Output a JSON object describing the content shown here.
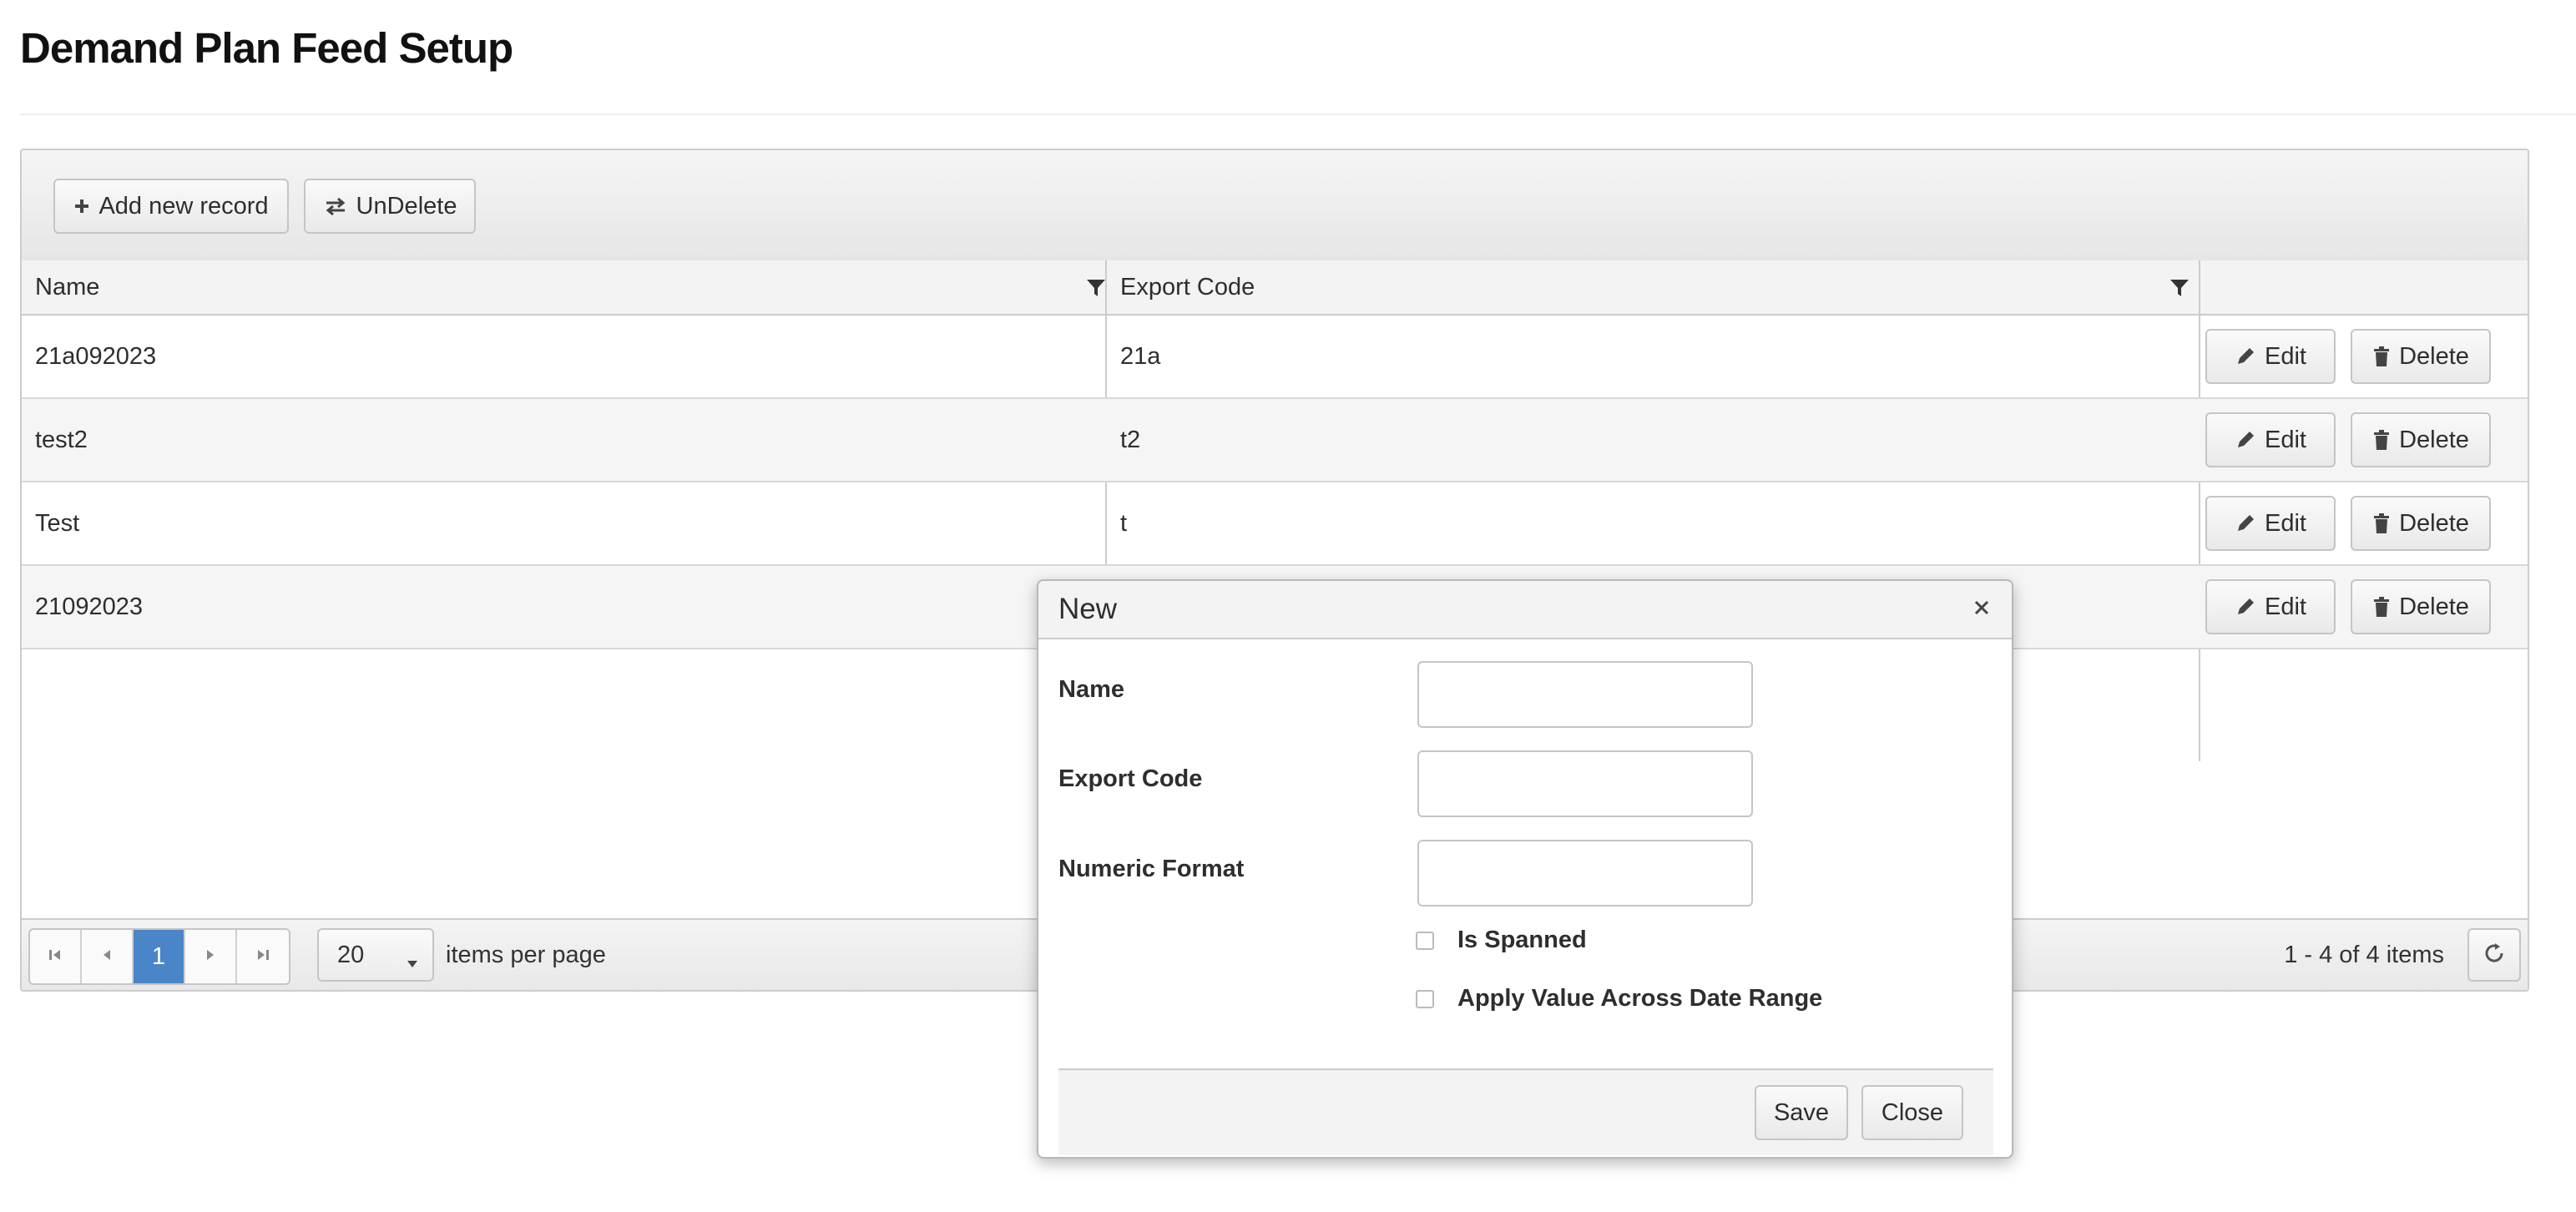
{
  "page": {
    "title": "Demand Plan Feed Setup"
  },
  "toolbar": {
    "add_label": "Add new record",
    "undelete_label": "UnDelete"
  },
  "grid": {
    "columns": [
      "Name",
      "Export Code"
    ],
    "rows": [
      {
        "name": "21a092023",
        "code": "21a"
      },
      {
        "name": "test2",
        "code": "t2"
      },
      {
        "name": "Test",
        "code": "t"
      },
      {
        "name": "21092023",
        "code": ""
      }
    ],
    "edit_label": "Edit",
    "delete_label": "Delete"
  },
  "pager": {
    "current_page": "1",
    "page_size": "20",
    "per_page_label": "items per page",
    "info": "1 - 4 of 4 items"
  },
  "dialog": {
    "title": "New",
    "fields": [
      {
        "label": "Name",
        "value": ""
      },
      {
        "label": "Export Code",
        "value": ""
      },
      {
        "label": "Numeric Format",
        "value": ""
      }
    ],
    "checkboxes": [
      {
        "label": "Is Spanned",
        "checked": false
      },
      {
        "label": "Apply Value Across Date Range",
        "checked": false
      }
    ],
    "save_label": "Save",
    "close_label": "Close"
  },
  "icons": {
    "add": "plus-icon",
    "undelete": "swap-arrows-icon",
    "filter": "funnel-icon",
    "edit": "pencil-icon",
    "delete": "trash-icon",
    "close": "close-icon",
    "first": "first-page-icon",
    "prev": "previous-page-icon",
    "next": "next-page-icon",
    "last": "last-page-icon",
    "refresh": "refresh-icon"
  },
  "colors": {
    "active_page": "#4a86c7"
  }
}
